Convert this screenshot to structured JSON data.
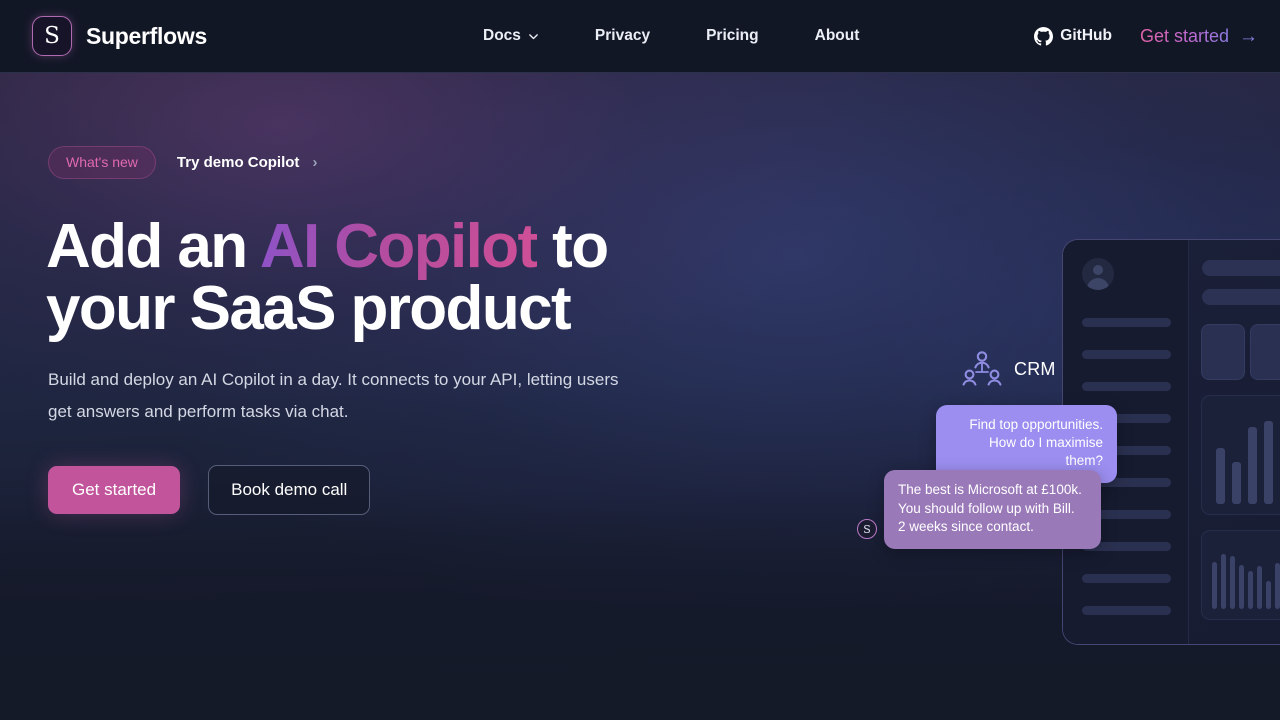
{
  "brand": {
    "logo_letter": "S",
    "name": "Superflows"
  },
  "nav": {
    "links": [
      {
        "label": "Docs",
        "has_dropdown": true,
        "icon": "chevron-down-icon"
      },
      {
        "label": "Privacy",
        "has_dropdown": false
      },
      {
        "label": "Pricing",
        "has_dropdown": false
      },
      {
        "label": "About",
        "has_dropdown": false
      }
    ],
    "github": {
      "label": "GitHub",
      "icon": "github-icon"
    },
    "get_started": {
      "label": "Get started",
      "arrow": "→"
    }
  },
  "hero": {
    "badge": {
      "pill_label": "What's new",
      "link_label": "Try demo Copilot",
      "chevron": "›"
    },
    "headline": {
      "part1": "Add an ",
      "highlight": "AI Copilot",
      "part2": " to",
      "line2": "your SaaS product"
    },
    "subtext_line1": "Build and deploy an AI Copilot in a day. It connects to your API, letting",
    "subtext_line2": "users get answers and perform tasks via chat.",
    "cta_primary": "Get started",
    "cta_secondary": "Book demo call"
  },
  "mockup": {
    "crm_label": "CRM",
    "crm_icon": "users-group-icon",
    "chat": {
      "user_message_line1": "Find top opportunities.",
      "user_message_line2": "How do I maximise them?",
      "bot_message_line1": "The best is Microsoft at £100k.",
      "bot_message_line2": "You should follow up with Bill.",
      "bot_message_line3": "2 weeks since contact.",
      "bot_avatar_letter": "S"
    }
  },
  "colors": {
    "page_bg": "#141929",
    "nav_bg": "#121726",
    "accent_pink": "#c2549c",
    "accent_purple": "#8c7ce0",
    "bubble_user": "#9b8ef0",
    "bubble_bot": "#9a79b9",
    "brand_border": "#b06bb0"
  }
}
